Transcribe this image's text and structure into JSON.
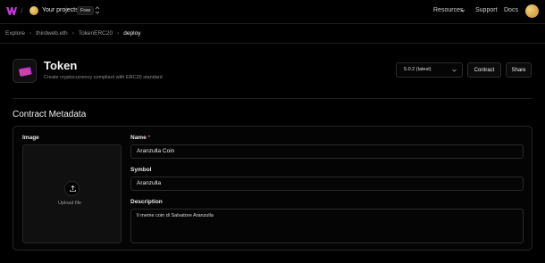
{
  "topbar": {
    "project_name": "Your projects",
    "plan_badge": "Free",
    "nav": {
      "resources": "Resources",
      "support": "Support",
      "docs": "Docs"
    }
  },
  "breadcrumb": [
    "Explore",
    "thirdweb.eth",
    "TokenERC20",
    "deploy"
  ],
  "contract": {
    "title": "Token",
    "subtitle": "Create cryptocurrency compliant with ERC20 standard",
    "version": "5.0.2 (latest)",
    "contract_button": "Contract",
    "share_button": "Share"
  },
  "metadata": {
    "section_title": "Contract Metadata",
    "image_label": "Image",
    "upload_label": "Upload file",
    "name_label": "Name",
    "name_required": "*",
    "name_value": "Aranzulla Coin",
    "symbol_label": "Symbol",
    "symbol_value": "Aranzulla",
    "description_label": "Description",
    "description_value": "Il meme coin di Salvatore Aranzulla"
  },
  "colors": {
    "background": "#000000",
    "required": "#e5484d",
    "accent_purple": "#c43bd9"
  }
}
